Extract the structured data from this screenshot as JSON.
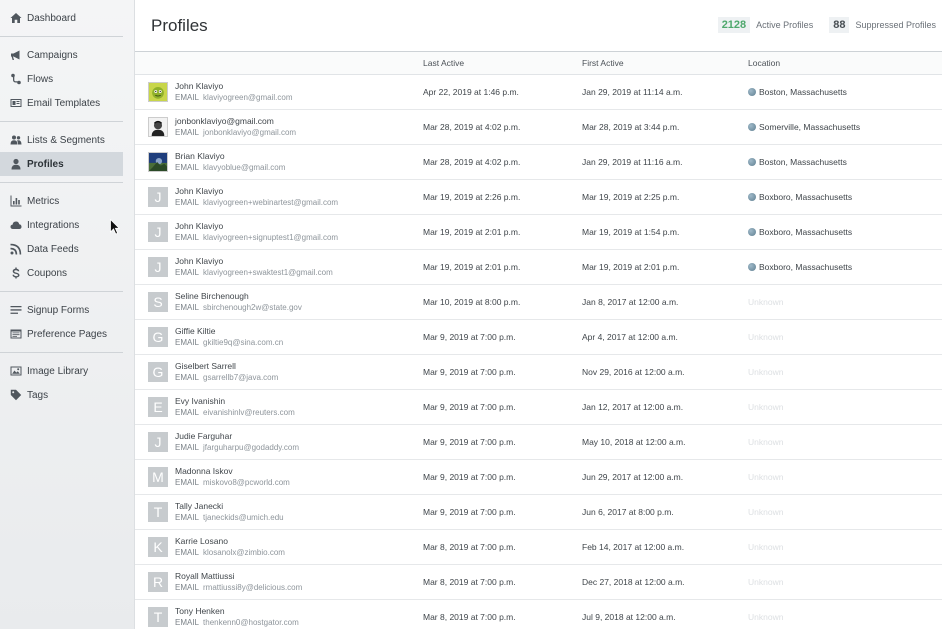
{
  "sidebar": {
    "groups": [
      [
        {
          "label": "Dashboard",
          "icon": "home-icon"
        }
      ],
      [
        {
          "label": "Campaigns",
          "icon": "megaphone-icon"
        },
        {
          "label": "Flows",
          "icon": "flow-icon"
        },
        {
          "label": "Email Templates",
          "icon": "template-icon"
        }
      ],
      [
        {
          "label": "Lists & Segments",
          "icon": "users-icon"
        },
        {
          "label": "Profiles",
          "icon": "user-icon",
          "active": true
        }
      ],
      [
        {
          "label": "Metrics",
          "icon": "bar-chart-icon"
        },
        {
          "label": "Integrations",
          "icon": "cloud-icon"
        },
        {
          "label": "Data Feeds",
          "icon": "rss-icon"
        },
        {
          "label": "Coupons",
          "icon": "dollar-icon"
        }
      ],
      [
        {
          "label": "Signup Forms",
          "icon": "form-icon"
        },
        {
          "label": "Preference Pages",
          "icon": "preferences-icon"
        }
      ],
      [
        {
          "label": "Image Library",
          "icon": "image-icon"
        },
        {
          "label": "Tags",
          "icon": "tag-icon"
        }
      ]
    ]
  },
  "header": {
    "title": "Profiles",
    "active_count": "2128",
    "active_label": "Active Profiles",
    "suppressed_count": "88",
    "suppressed_label": "Suppressed Profiles"
  },
  "table": {
    "columns": {
      "last": "Last Active",
      "first": "First Active",
      "location": "Location"
    },
    "email_tag": "EMAIL",
    "rows": [
      {
        "name": "John Klaviyo",
        "email": "klaviyogreen@gmail.com",
        "last": "Apr 22, 2019 at 1:46 p.m.",
        "first": "Jan 29, 2019 at 11:14 a.m.",
        "location": "Boston, Massachusetts",
        "avatar": "img-green"
      },
      {
        "name": "jonbonklaviyo@gmail.com",
        "email": "jonbonklaviyo@gmail.com",
        "last": "Mar 28, 2019 at 4:02 p.m.",
        "first": "Mar 28, 2019 at 3:44 p.m.",
        "location": "Somerville, Massachusetts",
        "avatar": "img-bw"
      },
      {
        "name": "Brian Klaviyo",
        "email": "klavyoblue@gmail.com",
        "last": "Mar 28, 2019 at 4:02 p.m.",
        "first": "Jan 29, 2019 at 11:16 a.m.",
        "location": "Boston, Massachusetts",
        "avatar": "img-blue"
      },
      {
        "name": "John Klaviyo",
        "email": "klaviyogreen+webinartest@gmail.com",
        "last": "Mar 19, 2019 at 2:26 p.m.",
        "first": "Mar 19, 2019 at 2:25 p.m.",
        "location": "Boxboro, Massachusetts",
        "avatar": "J"
      },
      {
        "name": "John Klaviyo",
        "email": "klaviyogreen+signuptest1@gmail.com",
        "last": "Mar 19, 2019 at 2:01 p.m.",
        "first": "Mar 19, 2019 at 1:54 p.m.",
        "location": "Boxboro, Massachusetts",
        "avatar": "J"
      },
      {
        "name": "John Klaviyo",
        "email": "klaviyogreen+swaktest1@gmail.com",
        "last": "Mar 19, 2019 at 2:01 p.m.",
        "first": "Mar 19, 2019 at 2:01 p.m.",
        "location": "Boxboro, Massachusetts",
        "avatar": "J"
      },
      {
        "name": "Seline Birchenough",
        "email": "sbirchenough2w@state.gov",
        "last": "Mar 10, 2019 at 8:00 p.m.",
        "first": "Jan 8, 2017 at 12:00 a.m.",
        "location": "Unknown",
        "avatar": "S"
      },
      {
        "name": "Giffie Kiltie",
        "email": "gkiltie9q@sina.com.cn",
        "last": "Mar 9, 2019 at 7:00 p.m.",
        "first": "Apr 4, 2017 at 12:00 a.m.",
        "location": "Unknown",
        "avatar": "G"
      },
      {
        "name": "Giselbert Sarrell",
        "email": "gsarrellb7@java.com",
        "last": "Mar 9, 2019 at 7:00 p.m.",
        "first": "Nov 29, 2016 at 12:00 a.m.",
        "location": "Unknown",
        "avatar": "G"
      },
      {
        "name": "Evy Ivanishin",
        "email": "eivanishinlv@reuters.com",
        "last": "Mar 9, 2019 at 7:00 p.m.",
        "first": "Jan 12, 2017 at 12:00 a.m.",
        "location": "Unknown",
        "avatar": "E"
      },
      {
        "name": "Judie Farguhar",
        "email": "jfarguharpu@godaddy.com",
        "last": "Mar 9, 2019 at 7:00 p.m.",
        "first": "May 10, 2018 at 12:00 a.m.",
        "location": "Unknown",
        "avatar": "J"
      },
      {
        "name": "Madonna Iskov",
        "email": "miskovo8@pcworld.com",
        "last": "Mar 9, 2019 at 7:00 p.m.",
        "first": "Jun 29, 2017 at 12:00 a.m.",
        "location": "Unknown",
        "avatar": "M"
      },
      {
        "name": "Tally Janecki",
        "email": "tjaneckids@umich.edu",
        "last": "Mar 9, 2019 at 7:00 p.m.",
        "first": "Jun 6, 2017 at 8:00 p.m.",
        "location": "Unknown",
        "avatar": "T"
      },
      {
        "name": "Karrie Losano",
        "email": "klosanolx@zimbio.com",
        "last": "Mar 8, 2019 at 7:00 p.m.",
        "first": "Feb 14, 2017 at 12:00 a.m.",
        "location": "Unknown",
        "avatar": "K"
      },
      {
        "name": "Royall Mattiussi",
        "email": "rmattiussi8y@delicious.com",
        "last": "Mar 8, 2019 at 7:00 p.m.",
        "first": "Dec 27, 2018 at 12:00 a.m.",
        "location": "Unknown",
        "avatar": "R"
      },
      {
        "name": "Tony Henken",
        "email": "thenkenn0@hostgator.com",
        "last": "Mar 8, 2019 at 7:00 p.m.",
        "first": "Jul 9, 2018 at 12:00 a.m.",
        "location": "Unknown",
        "avatar": "T"
      }
    ]
  }
}
